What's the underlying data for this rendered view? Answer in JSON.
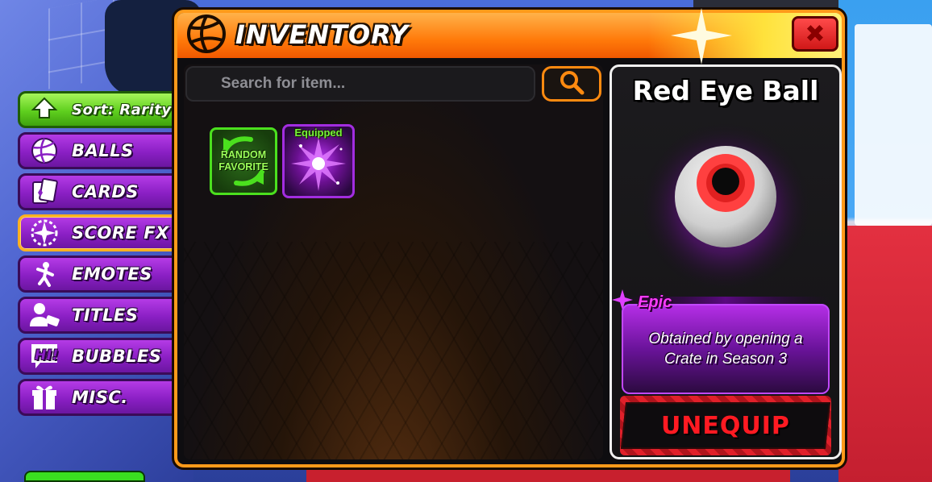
{
  "window": {
    "title": "INVENTORY",
    "close_icon": "x-icon"
  },
  "sidebar": {
    "items": [
      {
        "label": "Sort: Rarity",
        "icon": "sort-arrow-icon",
        "type": "sort"
      },
      {
        "label": "BALLS",
        "icon": "volleyball-icon"
      },
      {
        "label": "CARDS",
        "icon": "cards-icon"
      },
      {
        "label": "SCORE FX",
        "icon": "sparkle-burst-icon",
        "active": true
      },
      {
        "label": "EMOTES",
        "icon": "dancing-figure-icon"
      },
      {
        "label": "TITLES",
        "icon": "user-tag-icon"
      },
      {
        "label": "BUBBLES",
        "icon": "speech-bubble-hi-icon"
      },
      {
        "label": "MISC.",
        "icon": "gift-icon"
      }
    ]
  },
  "search": {
    "placeholder": "Search for item...",
    "icon": "search-icon"
  },
  "grid": {
    "items": [
      {
        "label": "RANDOM FAVORITE",
        "icon": "shuffle-icon"
      },
      {
        "label": "Equipped",
        "icon": "purple-burst-icon"
      }
    ]
  },
  "detail": {
    "title": "Red Eye Ball",
    "rarity": "Epic",
    "description": "Obtained by opening a Crate in Season 3",
    "action_label": "UNEQUIP",
    "preview_icon": "red-eye-ball-icon"
  },
  "colors": {
    "accent": "#ff9a1a",
    "rarity_epic": "#ff3cff",
    "unequip_red": "#ff1a22",
    "equipped_green": "#78f03a"
  }
}
